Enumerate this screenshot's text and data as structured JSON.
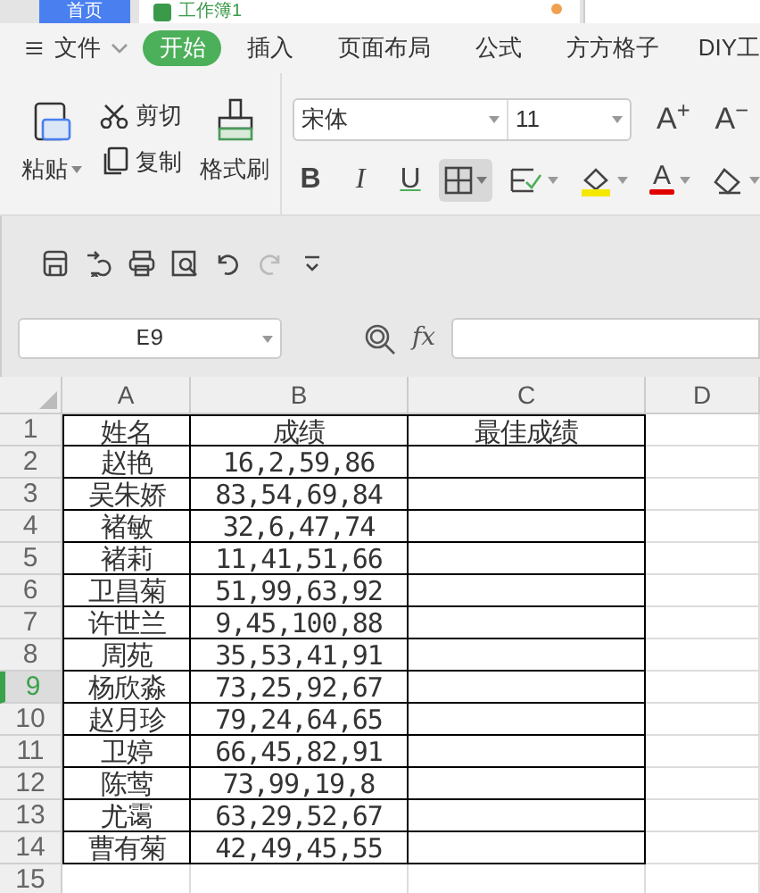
{
  "document_tabs": [
    {
      "label": "首页",
      "selected": false,
      "unsaved": false
    },
    {
      "label": "工作簿1",
      "selected": true,
      "unsaved": true
    }
  ],
  "menu": {
    "file": "文件",
    "tabs": [
      {
        "label": "开始",
        "selected": true
      },
      {
        "label": "插入",
        "selected": false
      },
      {
        "label": "页面布局",
        "selected": false
      },
      {
        "label": "公式",
        "selected": false
      },
      {
        "label": "方方格子",
        "selected": false
      },
      {
        "label": "DIY工",
        "selected": false
      }
    ]
  },
  "ribbon": {
    "paste": "粘贴",
    "cut": "剪切",
    "copy": "复制",
    "format_painter": "格式刷",
    "font_name": "宋体",
    "font_size": "11",
    "grow_font": "A$^{+}$",
    "shrink_font": "A$^{−}$",
    "bold": "B",
    "italic": "I",
    "underline": "U",
    "font_color": "A"
  },
  "quick_access": [
    {
      "kind": "save",
      "disabled": false
    },
    {
      "kind": "export",
      "disabled": false
    },
    {
      "kind": "print",
      "disabled": false
    },
    {
      "kind": "preview",
      "disabled": false
    },
    {
      "kind": "undo",
      "disabled": false
    },
    {
      "kind": "redo",
      "disabled": true
    },
    {
      "kind": "more",
      "disabled": false
    }
  ],
  "name_box": "E9",
  "fx": "fx",
  "columns": [
    "A",
    "B",
    "C",
    "D"
  ],
  "rows": [
    {
      "number": "1",
      "selected": false,
      "cells": [
        "姓名",
        "成绩",
        "最佳成绩"
      ]
    },
    {
      "number": "2",
      "selected": false,
      "cells": [
        "赵艳",
        "16,2,59,86",
        ""
      ]
    },
    {
      "number": "3",
      "selected": false,
      "cells": [
        "吴朱娇",
        "83,54,69,84",
        ""
      ]
    },
    {
      "number": "4",
      "selected": false,
      "cells": [
        "褚敏",
        "32,6,47,74",
        ""
      ]
    },
    {
      "number": "5",
      "selected": false,
      "cells": [
        "褚莉",
        "11,41,51,66",
        ""
      ]
    },
    {
      "number": "6",
      "selected": false,
      "cells": [
        "卫昌菊",
        "51,99,63,92",
        ""
      ]
    },
    {
      "number": "7",
      "selected": false,
      "cells": [
        "许世兰",
        "9,45,100,88",
        ""
      ]
    },
    {
      "number": "8",
      "selected": false,
      "cells": [
        "周苑",
        "35,53,41,91",
        ""
      ]
    },
    {
      "number": "9",
      "selected": true,
      "cells": [
        "杨欣淼",
        "73,25,92,67",
        ""
      ]
    },
    {
      "number": "10",
      "selected": false,
      "cells": [
        "赵月珍",
        "79,24,64,65",
        ""
      ]
    },
    {
      "number": "11",
      "selected": false,
      "cells": [
        "卫婷",
        "66,45,82,91",
        ""
      ]
    },
    {
      "number": "12",
      "selected": false,
      "cells": [
        "陈莺",
        "73,99,19,8",
        ""
      ]
    },
    {
      "number": "13",
      "selected": false,
      "cells": [
        "尤霭",
        "63,29,52,67",
        ""
      ]
    },
    {
      "number": "14",
      "selected": false,
      "cells": [
        "曹有菊",
        "42,49,45,55",
        ""
      ]
    },
    {
      "number": "15",
      "selected": false
    }
  ]
}
